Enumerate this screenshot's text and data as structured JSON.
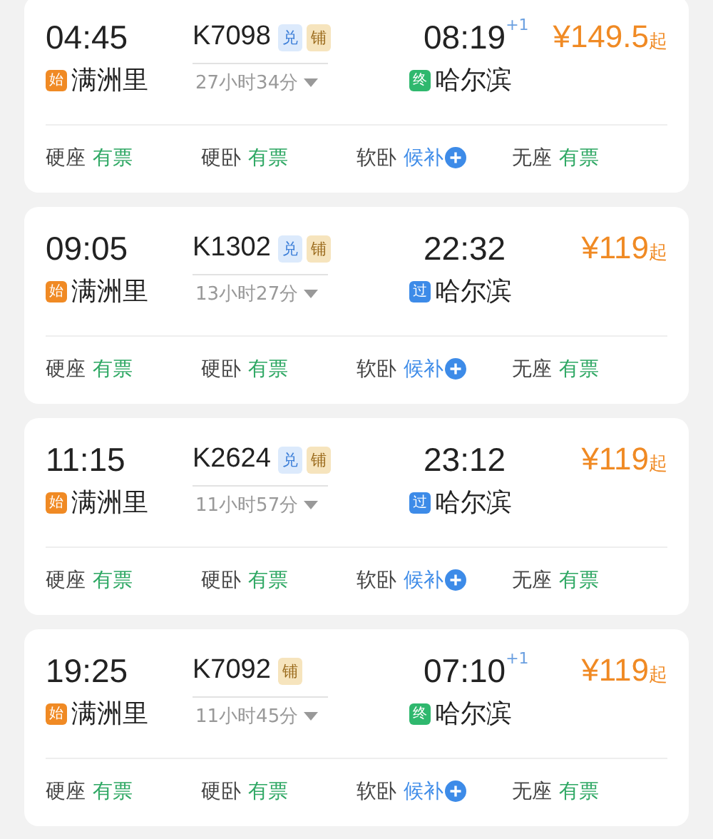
{
  "trains": [
    {
      "depart": "04:45",
      "train_no": "K7098",
      "tags": [
        {
          "label": "兑",
          "kind": "exchange"
        },
        {
          "label": "铺",
          "kind": "berth"
        }
      ],
      "duration": "27小时34分",
      "arrive": "08:19",
      "day_offset": "+1",
      "price": "¥149.5",
      "price_suffix": "起",
      "from_badge": {
        "label": "始",
        "kind": "start"
      },
      "from": "满洲里",
      "to_badge": {
        "label": "终",
        "kind": "end"
      },
      "to": "哈尔滨",
      "seats": [
        {
          "class": "硬座",
          "status": "有票",
          "kind": "available"
        },
        {
          "class": "硬卧",
          "status": "有票",
          "kind": "available"
        },
        {
          "class": "软卧",
          "status": "候补",
          "kind": "waitlist"
        },
        {
          "class": "无座",
          "status": "有票",
          "kind": "available"
        }
      ]
    },
    {
      "depart": "09:05",
      "train_no": "K1302",
      "tags": [
        {
          "label": "兑",
          "kind": "exchange"
        },
        {
          "label": "铺",
          "kind": "berth"
        }
      ],
      "duration": "13小时27分",
      "arrive": "22:32",
      "price": "¥119",
      "price_suffix": "起",
      "from_badge": {
        "label": "始",
        "kind": "start"
      },
      "from": "满洲里",
      "to_badge": {
        "label": "过",
        "kind": "pass"
      },
      "to": "哈尔滨",
      "seats": [
        {
          "class": "硬座",
          "status": "有票",
          "kind": "available"
        },
        {
          "class": "硬卧",
          "status": "有票",
          "kind": "available"
        },
        {
          "class": "软卧",
          "status": "候补",
          "kind": "waitlist"
        },
        {
          "class": "无座",
          "status": "有票",
          "kind": "available"
        }
      ]
    },
    {
      "depart": "11:15",
      "train_no": "K2624",
      "tags": [
        {
          "label": "兑",
          "kind": "exchange"
        },
        {
          "label": "铺",
          "kind": "berth"
        }
      ],
      "duration": "11小时57分",
      "arrive": "23:12",
      "price": "¥119",
      "price_suffix": "起",
      "from_badge": {
        "label": "始",
        "kind": "start"
      },
      "from": "满洲里",
      "to_badge": {
        "label": "过",
        "kind": "pass"
      },
      "to": "哈尔滨",
      "seats": [
        {
          "class": "硬座",
          "status": "有票",
          "kind": "available"
        },
        {
          "class": "硬卧",
          "status": "有票",
          "kind": "available"
        },
        {
          "class": "软卧",
          "status": "候补",
          "kind": "waitlist"
        },
        {
          "class": "无座",
          "status": "有票",
          "kind": "available"
        }
      ]
    },
    {
      "depart": "19:25",
      "train_no": "K7092",
      "tags": [
        {
          "label": "铺",
          "kind": "berth"
        }
      ],
      "duration": "11小时45分",
      "arrive": "07:10",
      "day_offset": "+1",
      "price": "¥119",
      "price_suffix": "起",
      "from_badge": {
        "label": "始",
        "kind": "start"
      },
      "from": "满洲里",
      "to_badge": {
        "label": "终",
        "kind": "end"
      },
      "to": "哈尔滨",
      "seats": [
        {
          "class": "硬座",
          "status": "有票",
          "kind": "available"
        },
        {
          "class": "硬卧",
          "status": "有票",
          "kind": "available"
        },
        {
          "class": "软卧",
          "status": "候补",
          "kind": "waitlist"
        },
        {
          "class": "无座",
          "status": "有票",
          "kind": "available"
        }
      ]
    }
  ]
}
